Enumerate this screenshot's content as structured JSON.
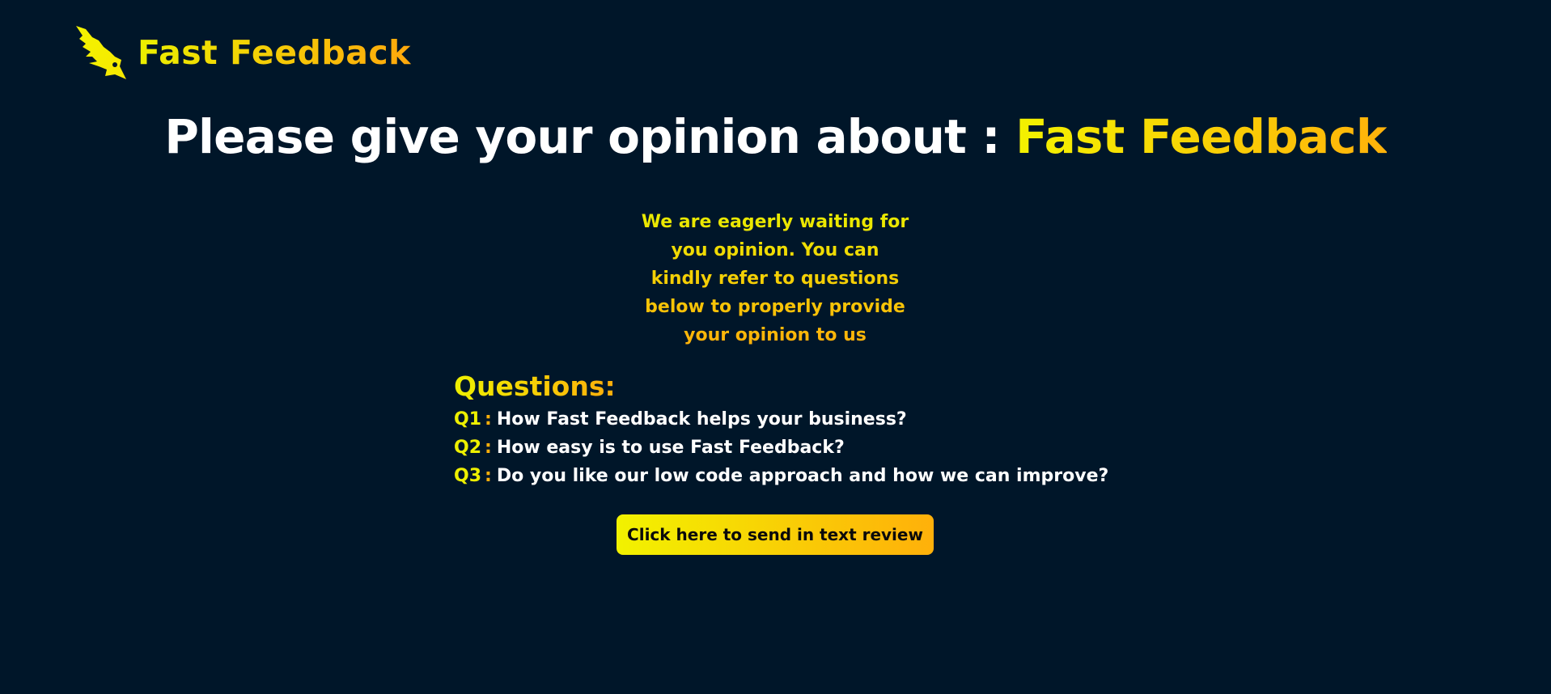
{
  "brand": {
    "name": "Fast Feedback",
    "logo_icon": "bird-dart-icon"
  },
  "colors": {
    "background": "#001629",
    "accent_start": "#eef000",
    "accent_end": "#ffb00a",
    "text": "#ffffff"
  },
  "headline": {
    "prefix": "Please give your opinion about : ",
    "accent": "Fast Feedback"
  },
  "intro": {
    "lines": [
      "We are eagerly waiting for",
      "you opinion. You can",
      "kindly refer to questions",
      "below to properly provide",
      "your opinion to us"
    ]
  },
  "questions": {
    "title": "Questions:",
    "items": [
      {
        "label": "Q1",
        "separator": ":",
        "text": "How Fast Feedback helps your business?"
      },
      {
        "label": "Q2",
        "separator": ":",
        "text": "How easy is to use Fast Feedback?"
      },
      {
        "label": "Q3",
        "separator": ":",
        "text": "Do you like our low code approach and how we can improve?"
      }
    ]
  },
  "cta": {
    "label": "Click here to send in text review"
  }
}
